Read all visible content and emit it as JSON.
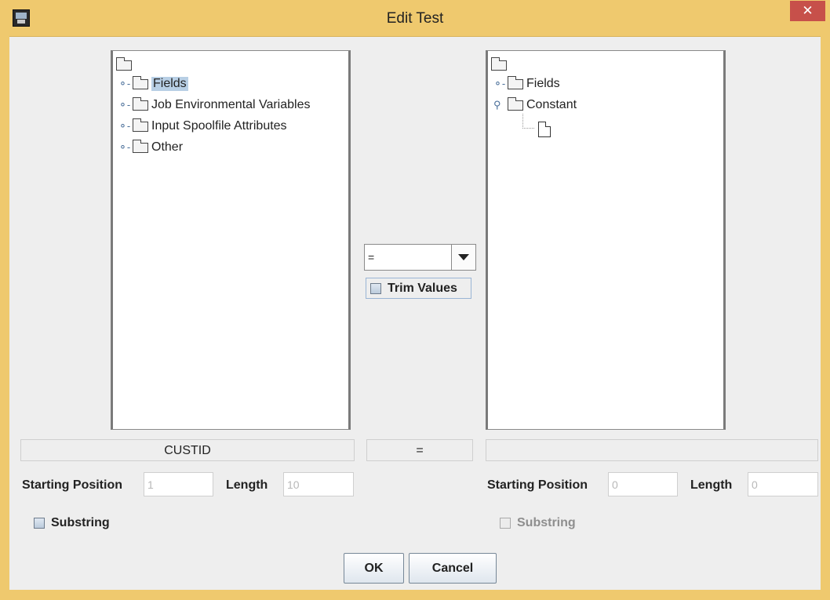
{
  "window": {
    "title": "Edit Test",
    "close_glyph": "✕",
    "icon": "app-icon"
  },
  "left_tree": {
    "nodes": [
      "Fields",
      "Job Environmental Variables",
      "Input Spoolfile Attributes",
      "Other"
    ]
  },
  "right_tree": {
    "nodes": [
      "Fields",
      "Constant"
    ]
  },
  "operator": {
    "selected": "="
  },
  "trim": {
    "label": "Trim Values"
  },
  "summary": {
    "left_field": "CUSTID",
    "operator": "=",
    "right_field": ""
  },
  "left_params": {
    "start_label": "Starting Position",
    "start_value": "1",
    "length_label": "Length",
    "length_value": "10",
    "substring_label": "Substring"
  },
  "right_params": {
    "start_label": "Starting Position",
    "start_value": "0",
    "length_label": "Length",
    "length_value": "0",
    "substring_label": "Substring"
  },
  "buttons": {
    "ok": "OK",
    "cancel": "Cancel"
  }
}
